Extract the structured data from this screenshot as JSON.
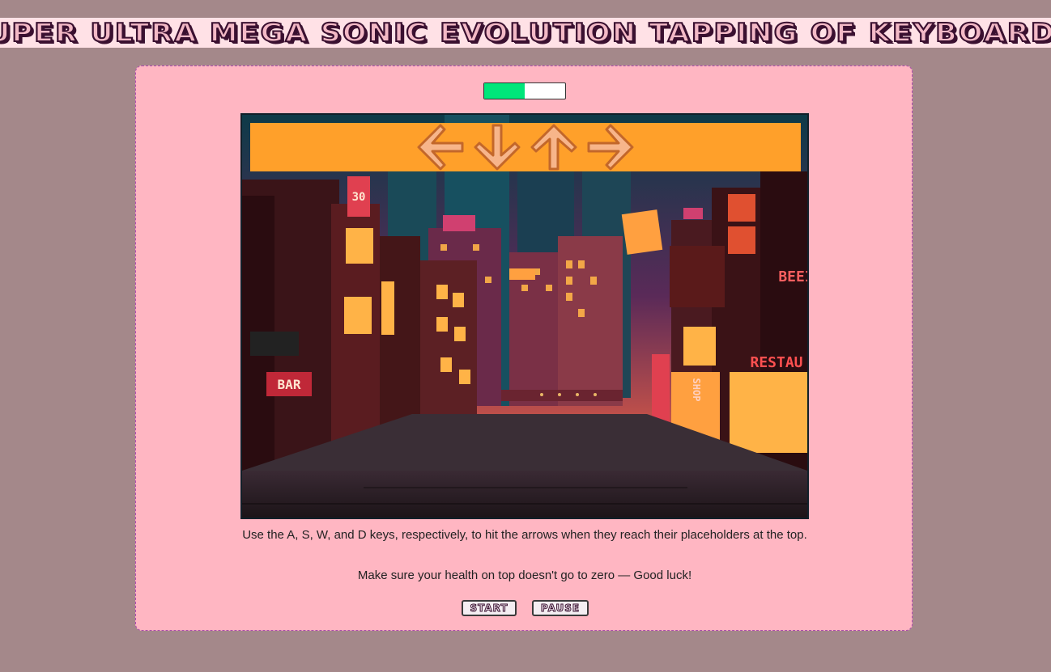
{
  "header": {
    "title": "Super Ultra Mega Sonic Evolution Tapping of Keyboard™"
  },
  "health": {
    "level_percent": 50,
    "fill_color": "#00e67a"
  },
  "game": {
    "lane_color": "#ffa02a",
    "arrows": [
      "left-arrow-icon",
      "down-arrow-icon",
      "up-arrow-icon",
      "right-arrow-icon"
    ],
    "signs": {
      "bar": "BAR",
      "shop": "SHOP",
      "restaurant": "RESTAU",
      "beer": "BEEI",
      "number": "30"
    }
  },
  "instructions": {
    "line1": "Use the A, S, W, and D keys, respectively, to hit the arrows when they reach their placeholders at the top.",
    "line2": "Make sure your health on top doesn't go to zero — Good luck!"
  },
  "controls": {
    "start_label": "Start",
    "pause_label": "Pause"
  }
}
